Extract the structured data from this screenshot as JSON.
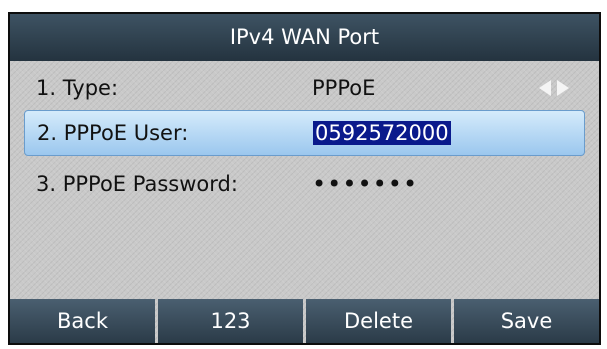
{
  "title": "IPv4 WAN Port",
  "rows": [
    {
      "label": "1. Type:",
      "value": "PPPoE"
    },
    {
      "label": "2. PPPoE User:",
      "value": "0592572000"
    },
    {
      "label": "3. PPPoE Password:",
      "value": "•••••••"
    }
  ],
  "softkeys": [
    "Back",
    "123",
    "Delete",
    "Save"
  ],
  "colors": {
    "title_bar": "#2f4150",
    "highlight": "#b4d6f5",
    "selection": "#0a1a8c",
    "background": "#c9c9c9"
  }
}
